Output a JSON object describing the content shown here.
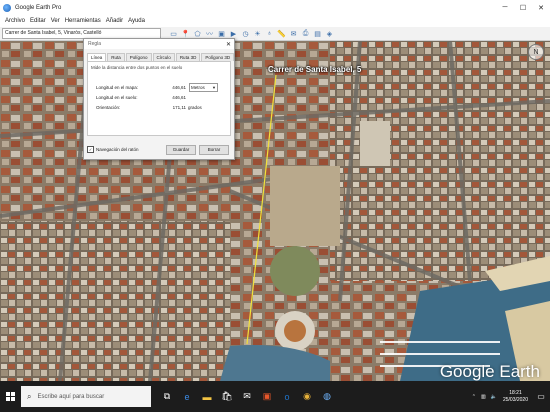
{
  "window": {
    "title": "Google Earth Pro",
    "minimize": "─",
    "maximize": "☐",
    "close": "✕"
  },
  "menu": [
    "Archivo",
    "Editar",
    "Ver",
    "Herramientas",
    "Añadir",
    "Ayuda"
  ],
  "toolbar": {
    "search_value": "Carrer de Santa Isabel, 5, Vinaròs, Castelló"
  },
  "map": {
    "place_label": "Carrer de Santa Isabel, 5",
    "logo": "Google Earth",
    "ruler_color": "#f2e13a"
  },
  "ruler_dialog": {
    "title": "Regla",
    "tabs": [
      "Línea",
      "Ruta",
      "Polígono",
      "Círculo",
      "Ruta 3D",
      "Polígono 3D"
    ],
    "active_tab": 0,
    "description": "Mide la distancia entre dos puntos en el suelo",
    "rows": [
      {
        "label": "Longitud en el mapa:",
        "value": "446,61",
        "unit_select": "Metros"
      },
      {
        "label": "Longitud en el suelo:",
        "value": "446,61",
        "unit": ""
      },
      {
        "label": "Orientación:",
        "value": "171,11",
        "unit": "grados"
      }
    ],
    "mouse_nav_label": "Navegación del ratón",
    "save_label": "Guardar",
    "clear_label": "Borrar"
  },
  "taskbar": {
    "search_placeholder": "Escribe aquí para buscar",
    "time": "18:21",
    "date": "25/03/2020"
  }
}
